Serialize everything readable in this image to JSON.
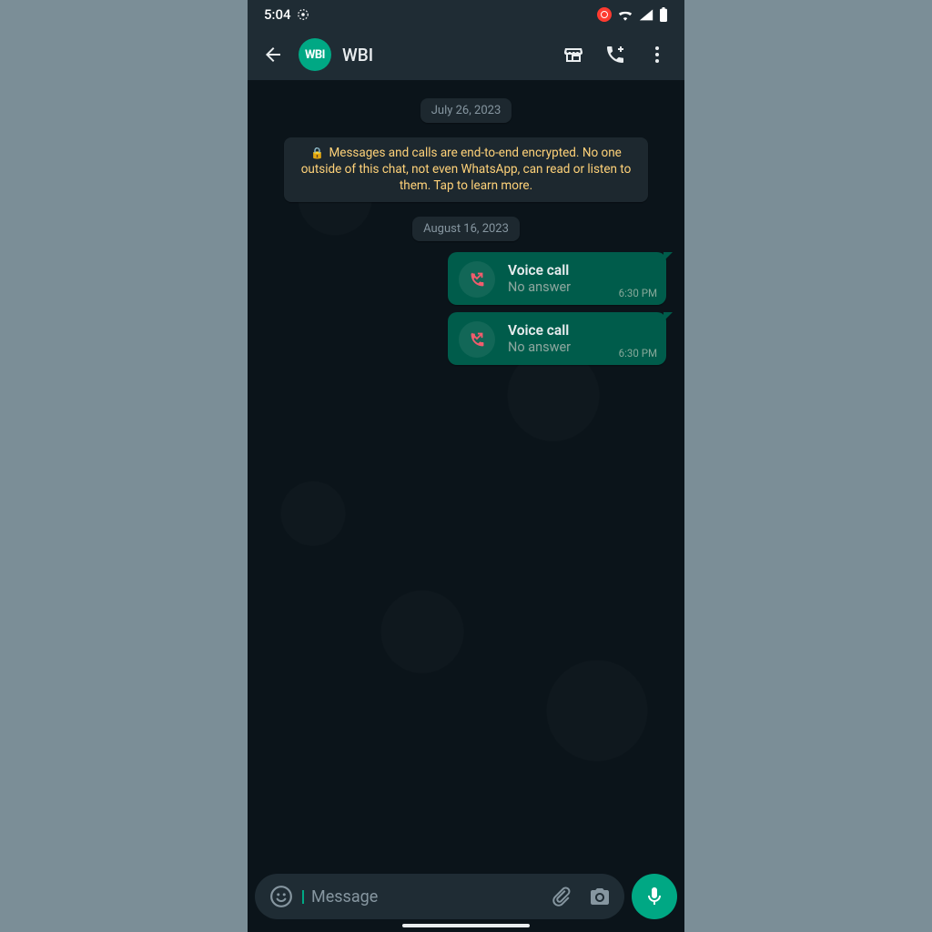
{
  "status": {
    "time": "5:04"
  },
  "header": {
    "avatar_initials": "WBI",
    "title": "WBI"
  },
  "chat": {
    "date_chips": [
      "July 26, 2023",
      "August 16, 2023"
    ],
    "encryption_notice": "Messages and calls are end-to-end encrypted. No one outside of this chat, not even WhatsApp, can read or listen to them. Tap to learn more.",
    "calls": [
      {
        "title": "Voice call",
        "subtitle": "No answer",
        "time": "6:30 PM"
      },
      {
        "title": "Voice call",
        "subtitle": "No answer",
        "time": "6:30 PM"
      }
    ]
  },
  "composer": {
    "placeholder": "Message"
  }
}
